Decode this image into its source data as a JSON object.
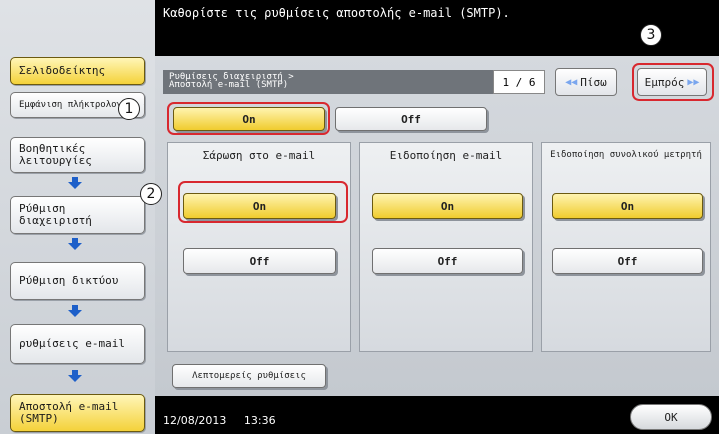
{
  "sidebar": {
    "bookmarks": "Σελιδοδείκτης",
    "display_count": "Εμφάνιση πλήκτρολογίου αφ",
    "utility": "Βοηθητικές λειτουργίες",
    "admin_settings": "Ρύθμιση διαχειριστή",
    "network_settings": "Ρύθμιση δικτύου",
    "email_settings": "ρυθμίσεις e-mail",
    "email_tx_smtp": "Αποστολή e-mail (SMTP)"
  },
  "header": {
    "instruction": "Καθορίστε τις ρυθμίσεις αποστολής e-mail (SMTP)."
  },
  "breadcrumb": {
    "line1": "Ρυθμίσεις διαχειριστή >",
    "line2": "Αποστολή e-mail (SMTP)"
  },
  "pagination": {
    "page": "1 / 6",
    "back_label": "Πίσω",
    "forward_label": "Εμπρός"
  },
  "smtp_toggle": {
    "on_label": "On",
    "off_label": "Off"
  },
  "columns": [
    {
      "title": "Σάρωση στο e-mail",
      "on": "On",
      "off": "Off"
    },
    {
      "title": "Ειδοποίηση e-mail",
      "on": "On",
      "off": "Off"
    },
    {
      "title": "Ειδοποίηση συνολικού μετρητή",
      "on": "On",
      "off": "Off"
    }
  ],
  "detail_settings": "Λεπτομερείς ρυθμίσεις",
  "footer": {
    "date": "12/08/2013",
    "time": "13:36",
    "ok_label": "OK"
  },
  "callouts": [
    "1",
    "2",
    "3"
  ],
  "colors": {
    "selected_yellow": "#f0cc2e",
    "highlight_red": "#d8282f",
    "arrow_blue": "#1d5fc9"
  }
}
